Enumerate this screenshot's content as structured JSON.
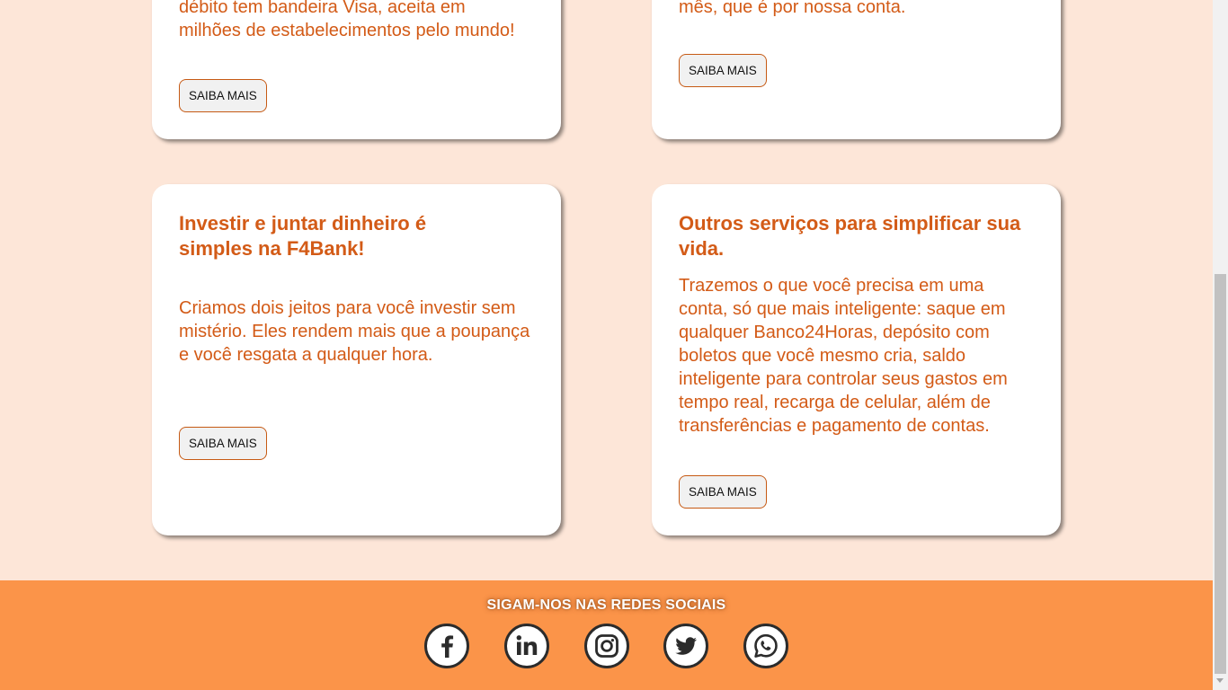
{
  "cards": [
    {
      "text": "débito tem bandeira Visa, aceita em milhões de estabelecimentos pelo mundo!",
      "button": "SAIBA MAIS"
    },
    {
      "text": "mês, que é por nossa conta.",
      "button": "SAIBA MAIS"
    },
    {
      "title": "Investir e juntar dinheiro é simples na F4Bank!",
      "text": "Criamos dois jeitos para você investir sem mistério. Eles rendem mais que a poupança e você resgata a qualquer hora.",
      "button": "SAIBA MAIS"
    },
    {
      "title": "Outros serviços para simplificar sua vida.",
      "text": "Trazemos o que você precisa em uma conta, só que mais inteligente: saque em qualquer Banco24Horas, depósito com boletos que você mesmo cria, saldo inteligente para controlar seus gastos em tempo real, recarga de celular, além de transferências e pagamento de contas.",
      "button": "SAIBA MAIS"
    }
  ],
  "footer": {
    "title": "SIGAM-NOS NAS REDES SOCIAIS",
    "socials": [
      "facebook-icon",
      "linkedin-icon",
      "instagram-icon",
      "twitter-icon",
      "whatsapp-icon"
    ]
  },
  "colors": {
    "page_bg": "#fde6d8",
    "accent_text": "#d35b17",
    "footer_bg": "#fb9449",
    "button_border": "#c65a14"
  }
}
